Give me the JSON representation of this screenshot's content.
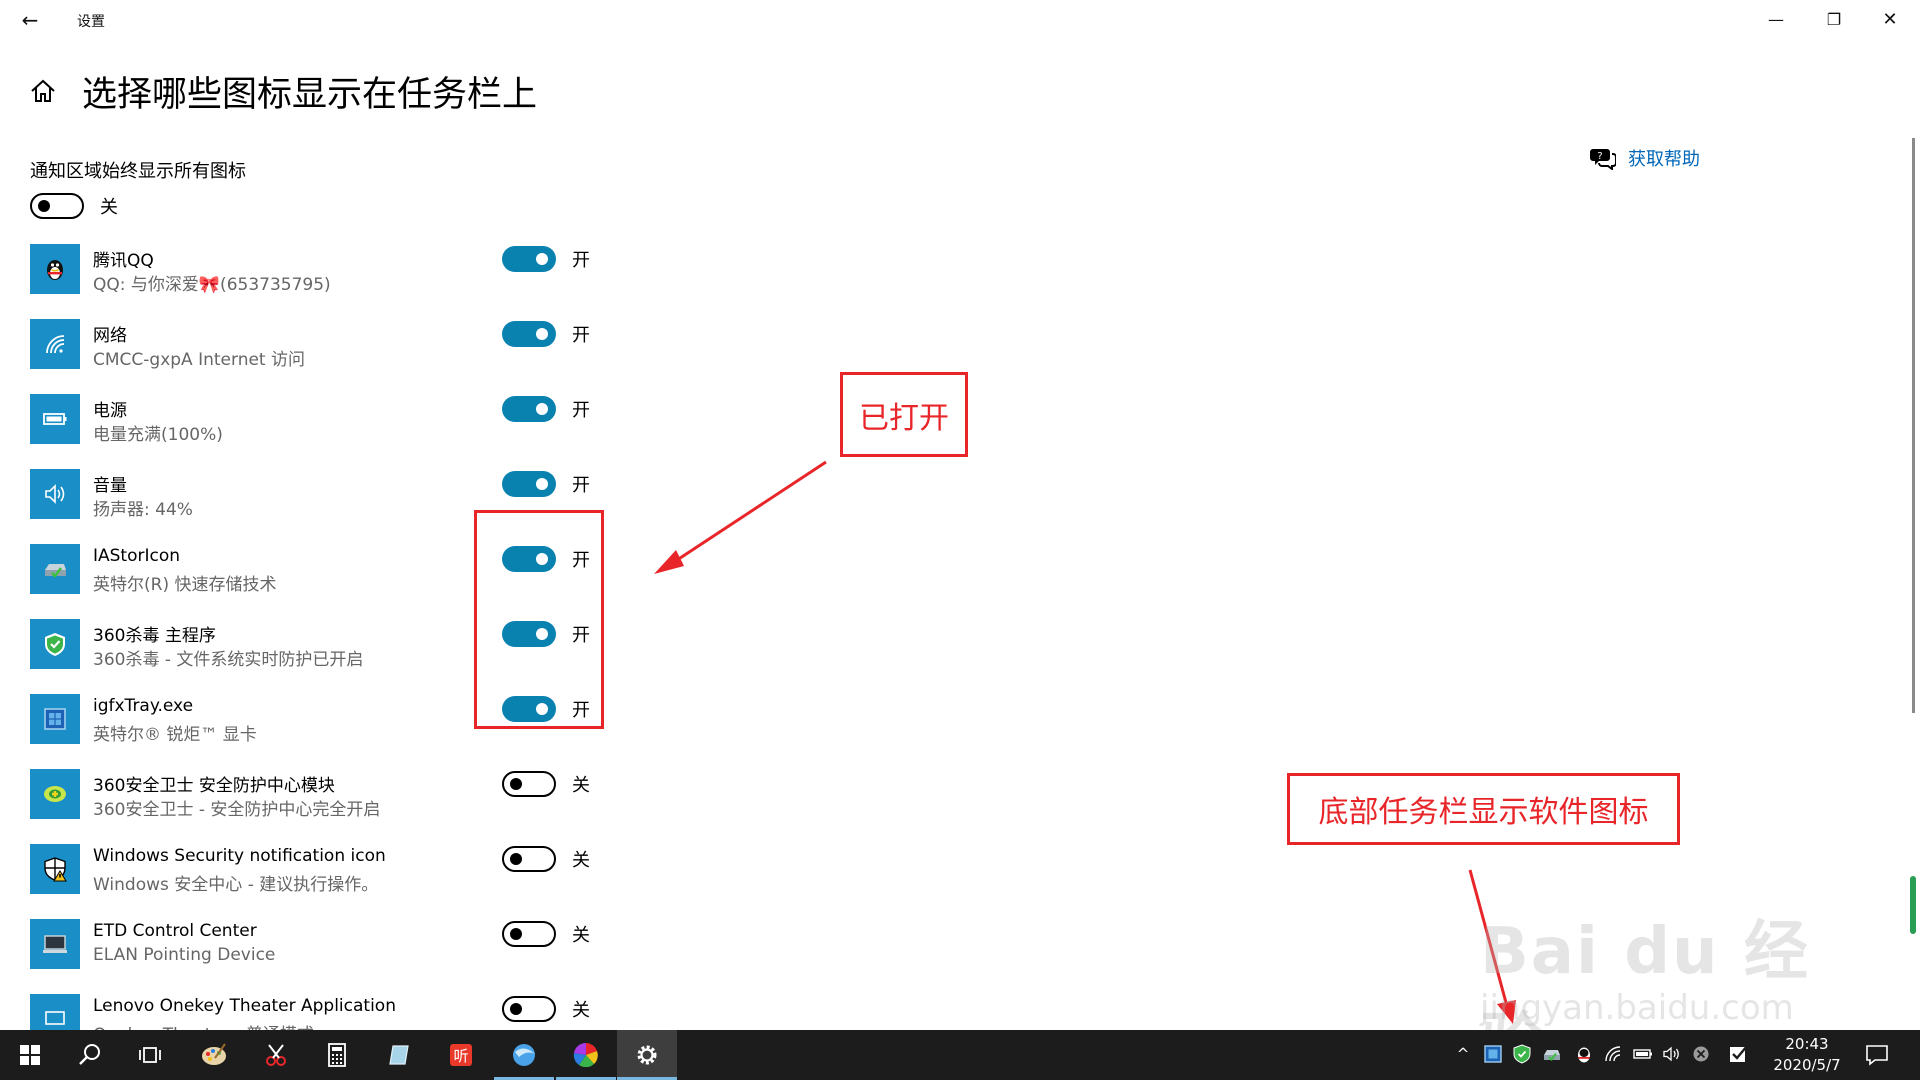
{
  "window": {
    "app_name": "设置",
    "back_icon": "←",
    "min_icon": "—",
    "max_icon": "❐",
    "close_icon": "✕"
  },
  "page": {
    "title": "选择哪些图标显示在任务栏上",
    "help_label": "获取帮助",
    "section_label": "通知区域始终显示所有图标",
    "master_toggle": {
      "state": "off",
      "label": "关"
    }
  },
  "items": [
    {
      "name": "腾讯QQ",
      "desc": "QQ: 与你深爱🎀(653735795)",
      "state": "on",
      "label": "开",
      "icon": "qq-penguin-icon"
    },
    {
      "name": "网络",
      "desc": "CMCC-gxpA Internet 访问",
      "state": "on",
      "label": "开",
      "icon": "wifi-icon"
    },
    {
      "name": "电源",
      "desc": "电量充满(100%)",
      "state": "on",
      "label": "开",
      "icon": "battery-icon"
    },
    {
      "name": "音量",
      "desc": "扬声器: 44%",
      "state": "on",
      "label": "开",
      "icon": "speaker-icon"
    },
    {
      "name": "IAStorIcon",
      "desc": "英特尔(R) 快速存储技术",
      "state": "on",
      "label": "开",
      "icon": "storage-drive-icon"
    },
    {
      "name": "360杀毒 主程序",
      "desc": "360杀毒 - 文件系统实时防护已开启",
      "state": "on",
      "label": "开",
      "icon": "green-shield-icon"
    },
    {
      "name": "igfxTray.exe",
      "desc": "英特尔® 锐炬™ 显卡",
      "state": "on",
      "label": "开",
      "icon": "intel-graphics-icon"
    },
    {
      "name": "360安全卫士 安全防护中心模块",
      "desc": "360安全卫士 - 安全防护中心完全开启",
      "state": "off",
      "label": "关",
      "icon": "security-guard-icon"
    },
    {
      "name": "Windows Security notification icon",
      "desc": "Windows 安全中心 - 建议执行操作。",
      "state": "off",
      "label": "关",
      "icon": "windows-security-shield-icon"
    },
    {
      "name": "ETD Control Center",
      "desc": "ELAN Pointing Device",
      "state": "off",
      "label": "关",
      "icon": "touchpad-monitor-icon"
    },
    {
      "name": "Lenovo Onekey Theater Application",
      "desc": "Onekey Theater - 普通模式",
      "state": "off",
      "label": "关",
      "icon": "theater-icon"
    }
  ],
  "annotations": {
    "opened": "已打开",
    "taskbar_note": "底部任务栏显示软件图标",
    "color": "#e8262a"
  },
  "watermark": {
    "main": "Bai du 经验",
    "sub": "jingyan.baidu.com"
  },
  "taskbar": {
    "time": "20:43",
    "date": "2020/5/7",
    "tray_chevron": "^"
  },
  "colors": {
    "accent": "#0a82b0",
    "tile": "#1a8fc7",
    "link": "#0067b8",
    "taskbar": "#1c1c1c"
  }
}
